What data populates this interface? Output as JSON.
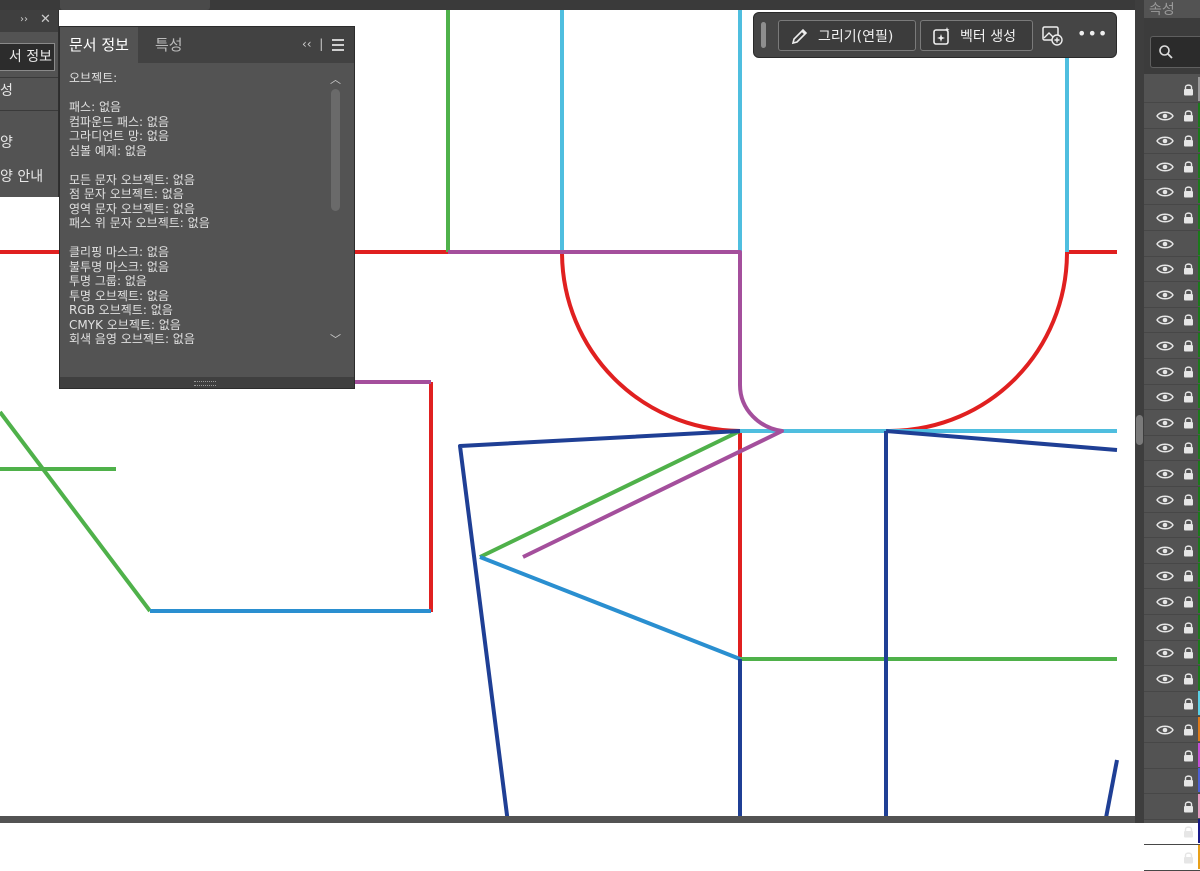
{
  "doc_info_panel": {
    "tab_active": "문서 정보",
    "tab_inactive": "특성",
    "lines": [
      "오브젝트:",
      "",
      "패스: 없음",
      "컴파운드 패스: 없음",
      "그라디언트 망: 없음",
      "심볼 예제: 없음",
      "",
      "모든 문자 오브젝트: 없음",
      "점 문자 오브젝트: 없음",
      "영역 문자 오브젝트: 없음",
      "패스 위 문자 오브젝트: 없음",
      "",
      "클리핑 마스크: 없음",
      "불투명 마스크: 없음",
      "투명 그룹: 없음",
      "투명 오브젝트: 없음",
      "RGB 오브젝트: 없음",
      "CMYK 오브젝트: 없음",
      "회색 음영 오브젝트: 없음"
    ]
  },
  "left_panel": {
    "tab_label": "서 정보",
    "item_1": "성",
    "item_2": "양",
    "item_3": "양 안내"
  },
  "context_bar": {
    "draw_label": "그리기(연필)",
    "vector_label": "벡터 생성",
    "more_label": "•••"
  },
  "right_panel": {
    "title": "속성",
    "layers": [
      {
        "eye": false,
        "lock": true,
        "color": "#9a9a9a"
      },
      {
        "eye": true,
        "lock": true,
        "color": "#1a7a1a"
      },
      {
        "eye": true,
        "lock": true,
        "color": "#1a7a1a"
      },
      {
        "eye": true,
        "lock": true,
        "color": "#1a7a1a"
      },
      {
        "eye": true,
        "lock": true,
        "color": "#1a7a1a"
      },
      {
        "eye": true,
        "lock": true,
        "color": "#1a7a1a"
      },
      {
        "eye": true,
        "lock": false,
        "color": "#1a7a1a"
      },
      {
        "eye": true,
        "lock": true,
        "color": "#1a7a1a"
      },
      {
        "eye": true,
        "lock": true,
        "color": "#1a7a1a"
      },
      {
        "eye": true,
        "lock": true,
        "color": "#1a7a1a"
      },
      {
        "eye": true,
        "lock": true,
        "color": "#1a7a1a"
      },
      {
        "eye": true,
        "lock": true,
        "color": "#1a7a1a"
      },
      {
        "eye": true,
        "lock": true,
        "color": "#1a7a1a"
      },
      {
        "eye": true,
        "lock": true,
        "color": "#1a7a1a"
      },
      {
        "eye": true,
        "lock": true,
        "color": "#1a7a1a"
      },
      {
        "eye": true,
        "lock": true,
        "color": "#1a7a1a"
      },
      {
        "eye": true,
        "lock": true,
        "color": "#1a7a1a"
      },
      {
        "eye": true,
        "lock": true,
        "color": "#1a7a1a"
      },
      {
        "eye": true,
        "lock": true,
        "color": "#1a7a1a"
      },
      {
        "eye": true,
        "lock": true,
        "color": "#1a7a1a"
      },
      {
        "eye": true,
        "lock": true,
        "color": "#1a7a1a"
      },
      {
        "eye": true,
        "lock": true,
        "color": "#1a7a1a"
      },
      {
        "eye": true,
        "lock": true,
        "color": "#1a7a1a"
      },
      {
        "eye": true,
        "lock": true,
        "color": "#1a7a1a"
      },
      {
        "eye": false,
        "lock": true,
        "color": "#5ad1e6"
      },
      {
        "eye": true,
        "lock": true,
        "color": "#e07a1a"
      },
      {
        "eye": false,
        "lock": true,
        "color": "#c64fd6"
      },
      {
        "eye": false,
        "lock": true,
        "color": "#4f5fd6"
      },
      {
        "eye": false,
        "lock": true,
        "color": "#e89ac0"
      },
      {
        "eye": false,
        "lock": true,
        "color": "#1a1a8a"
      },
      {
        "eye": false,
        "lock": true,
        "color": "#e8a01a"
      }
    ]
  },
  "artwork_colors": {
    "red": "#e02020",
    "green": "#4fb14a",
    "cyan": "#4fbedf",
    "purple": "#a44f9c",
    "navy": "#1f3f95",
    "blue": "#2a8fd0"
  }
}
